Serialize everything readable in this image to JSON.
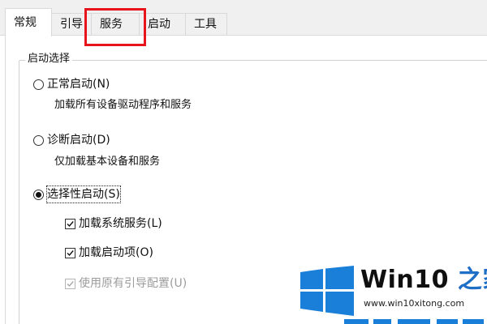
{
  "tabs": [
    {
      "label": "常规",
      "active": true
    },
    {
      "label": "引导",
      "active": false
    },
    {
      "label": "服务",
      "active": false
    },
    {
      "label": "启动",
      "active": false
    },
    {
      "label": "工具",
      "active": false
    }
  ],
  "startup_selection": {
    "group_title": "启动选择",
    "options": [
      {
        "label": "正常启动(N)",
        "description": "加载所有设备驱动程序和服务",
        "checked": false
      },
      {
        "label": "诊断启动(D)",
        "description": "仅加载基本设备和服务",
        "checked": false
      },
      {
        "label": "选择性启动(S)",
        "checked": true
      }
    ],
    "selective_items": [
      {
        "label": "加载系统服务(L)",
        "checked": true,
        "enabled": true
      },
      {
        "label": "加载启动项(O)",
        "checked": true,
        "enabled": true
      },
      {
        "label": "使用原有引导配置(U)",
        "checked": true,
        "enabled": false
      }
    ]
  },
  "highlight": {
    "target": "tab-services",
    "color": "#e8141b"
  },
  "watermark": {
    "brand_prefix": "Win10",
    "brand_suffix": " 之家",
    "url": "www.win10xitong.com",
    "colors": {
      "flag": "#1a7fd8",
      "accent": "#1f6fc6"
    },
    "icon": "windows-logo-icon"
  }
}
